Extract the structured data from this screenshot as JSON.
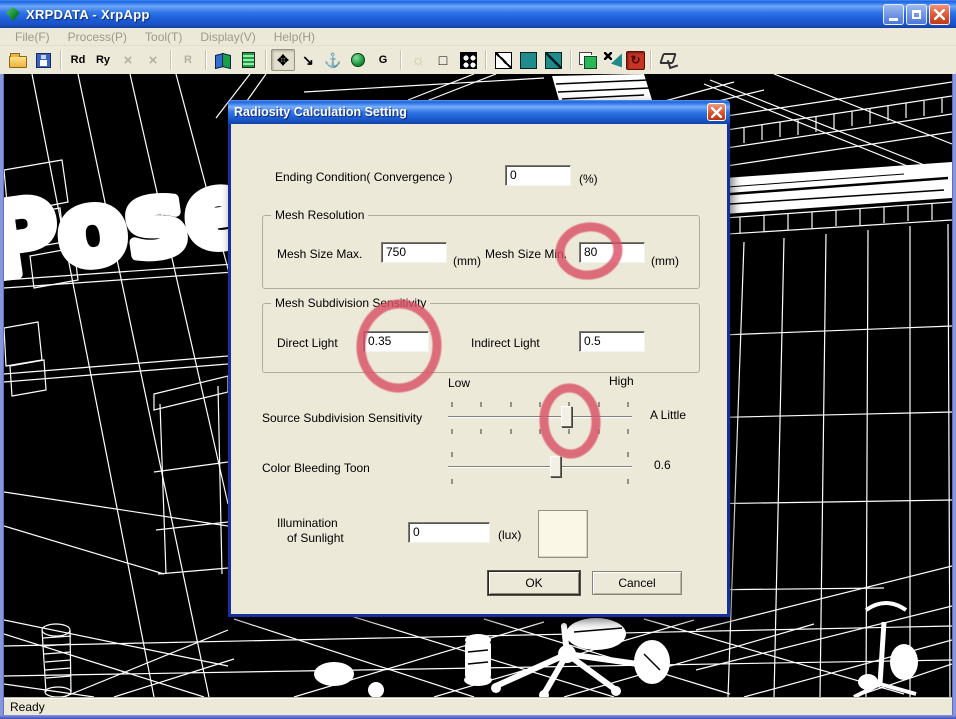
{
  "window": {
    "title": "XRPDATA - XrpApp",
    "controls": [
      "minimize-icon",
      "maximize-icon",
      "close-icon"
    ]
  },
  "menu": {
    "items": [
      {
        "id": "file",
        "label": "File(F)"
      },
      {
        "id": "process",
        "label": "Process(P)"
      },
      {
        "id": "tool",
        "label": "Tool(T)"
      },
      {
        "id": "display",
        "label": "Display(V)"
      },
      {
        "id": "help",
        "label": "Help(H)"
      }
    ]
  },
  "toolbar": {
    "buttons": [
      {
        "name": "open",
        "icon": "i-folder"
      },
      {
        "name": "save",
        "icon": "i-floppy"
      },
      {
        "sep": true
      },
      {
        "name": "rd",
        "glyph": "Rd",
        "cls": "t-text"
      },
      {
        "name": "ry",
        "glyph": "Ry",
        "cls": "t-text"
      },
      {
        "name": "delete-x-1",
        "glyph": "×",
        "cls": "t-x",
        "state": "disabled"
      },
      {
        "name": "delete-x-2",
        "glyph": "×",
        "cls": "t-x",
        "state": "disabled"
      },
      {
        "sep": true
      },
      {
        "name": "r",
        "glyph": "R",
        "cls": "t-text",
        "state": "disabled"
      },
      {
        "sep": true
      },
      {
        "name": "flip-view",
        "icon": "i-flip"
      },
      {
        "name": "column-render",
        "icon": "i-stripes"
      },
      {
        "sep": true
      },
      {
        "name": "pan",
        "glyph": "✥",
        "cls": "t-black",
        "state": "pressed"
      },
      {
        "name": "zoom",
        "glyph": "↘",
        "cls": "t-black"
      },
      {
        "name": "rotate-view",
        "glyph": "⚓",
        "cls": "t-black"
      },
      {
        "name": "sphere-view",
        "icon": "i-sphere"
      },
      {
        "name": "rotate-g",
        "glyph": "G",
        "cls": "t-text"
      },
      {
        "sep": true
      },
      {
        "name": "light",
        "glyph": "☼",
        "cls": "t-sun"
      },
      {
        "name": "square-outline",
        "glyph": "□",
        "cls": "t-black"
      },
      {
        "name": "dither-grid",
        "icon": "i-dots"
      },
      {
        "sep": true
      },
      {
        "name": "crossed-square",
        "icon": "i-crossed"
      },
      {
        "name": "teal-square",
        "icon": "i-teal"
      },
      {
        "name": "teal-diagonal-square",
        "icon": "i-teal-diag"
      },
      {
        "sep": true
      },
      {
        "name": "overlap-squares",
        "icon": "i-overlap"
      },
      {
        "name": "delete-mesh",
        "icon": "i-flagx"
      },
      {
        "name": "radiosity-toggle",
        "glyph": "↻",
        "cls": "t-red",
        "state": "pressed"
      },
      {
        "sep": true
      },
      {
        "name": "lamp",
        "icon": "i-lamp"
      }
    ]
  },
  "dialog": {
    "title": "Radiosity Calculation Setting",
    "ending": {
      "label": "Ending Condition( Convergence )",
      "value": "0",
      "unit": "(%)"
    },
    "mesh_resolution": {
      "legend": "Mesh Resolution",
      "max": {
        "label": "Mesh Size Max.",
        "value": "750",
        "unit": "(mm)"
      },
      "min": {
        "label": "Mesh Size Min.",
        "value": "80",
        "unit": "(mm)"
      }
    },
    "mesh_subdivision": {
      "legend": "Mesh Subdivision Sensitivity",
      "direct": {
        "label": "Direct Light",
        "value": "0.35"
      },
      "indirect": {
        "label": "Indirect Light",
        "value": "0.5"
      }
    },
    "sliders": {
      "low_label": "Low",
      "high_label": "High",
      "source": {
        "label": "Source Subdivision Sensitivity",
        "value_label": "A Little",
        "percent": 64,
        "ticks": 7
      },
      "bleed": {
        "label": "Color Bleeding Toon",
        "value_label": "0.6",
        "percent": 58,
        "ticks": 2
      }
    },
    "sunlight": {
      "label_line1": "Illumination",
      "label_line2": "of Sunlight",
      "value": "0",
      "unit": "(lux)",
      "swatch_color": "#FBF7E6"
    },
    "buttons": {
      "ok": "OK",
      "cancel": "Cancel"
    }
  },
  "statusbar": {
    "text": "Ready"
  },
  "colors": {
    "annotation": "#D95066",
    "titlebar_blue": "#2E74E8",
    "dialog_frame": "#16309F",
    "canvas_bg": "#000000"
  }
}
